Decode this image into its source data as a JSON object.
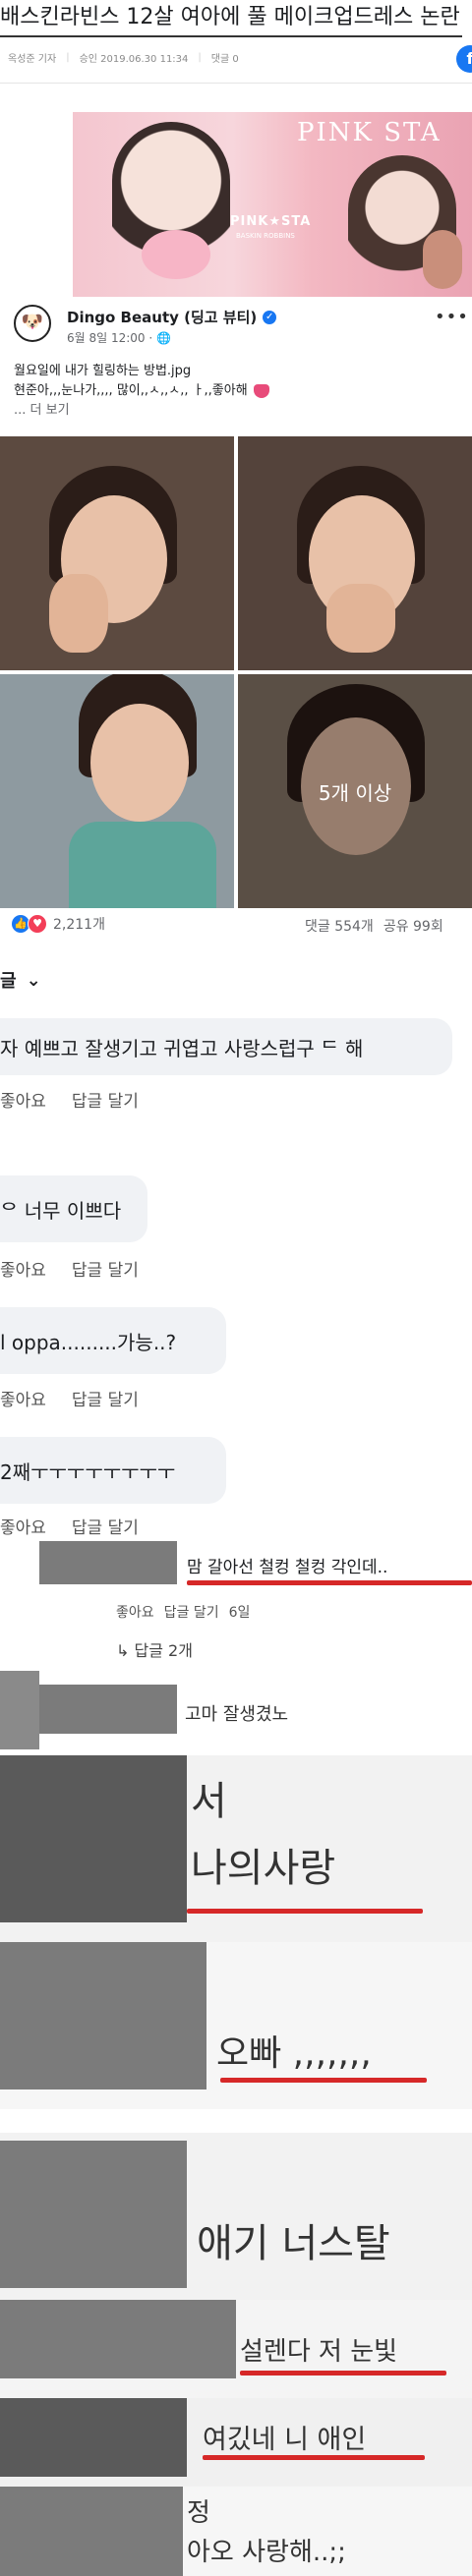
{
  "article": {
    "title": "배스킨라빈스 12살 여아에 풀 메이크업드레스 논란",
    "reporter": "옥성준 기자",
    "published": "승인 2019.06.30 11:34",
    "comments": "댓글 0",
    "share_icon": "facebook-icon"
  },
  "banner": {
    "brand_small": "PINK★STA",
    "brand_small_sub": "BASKIN ROBBINS",
    "brand_large": "PINK STA"
  },
  "post": {
    "page_name": "Dingo Beauty (딩고 뷰티)",
    "date": "6월 8일 12:00 · 🌐",
    "line1": "월요일에 내가 힐링하는 방법.jpg",
    "line2": "현준아,,,눈나가,,,, 많이,,ㅅ,,ㅅ,, ㅏ,,좋아해",
    "see_more": "... 더 보기",
    "more_photos": "5개 이상",
    "reactions_count": "2,211개",
    "comment_count": "댓글 554개",
    "share_count": "공유 99회"
  },
  "comments_header": {
    "label": "글",
    "chevron": "chevron-down-icon"
  },
  "comments": [
    {
      "text": "자 예쁘고 잘생기고 귀엽고 사랑스럽구 ᄃ 해"
    },
    {
      "text": "ᄋ 너무 이쁘다"
    },
    {
      "text": "l oppa.........가능..?"
    },
    {
      "text": "2째ㅜㅜㅜㅜㅜㅜㅜㅜ"
    }
  ],
  "actions": {
    "like": "좋아요",
    "reply": "답글 달기"
  },
  "screens": {
    "c5_text": "맘 갈아선 철컹 철컹 각인데..",
    "c5_meta_like": "좋아요",
    "c5_meta_reply": "답글 달기",
    "c5_meta_time": "6일",
    "c5_replies": "↳ 답글 2개",
    "c6_text": "고마 잘생겼노",
    "c7_line1": "서",
    "c7_line2": "나의사랑",
    "c8_text": "오빠 ,,,,,,,",
    "c9_text": "애기 너스탈",
    "c10_text": "설렌다 저 눈빛",
    "c11_text": "여깄네 니 애인",
    "c12_line1": "정",
    "c12_line2": "아오 사랑해..;;"
  }
}
